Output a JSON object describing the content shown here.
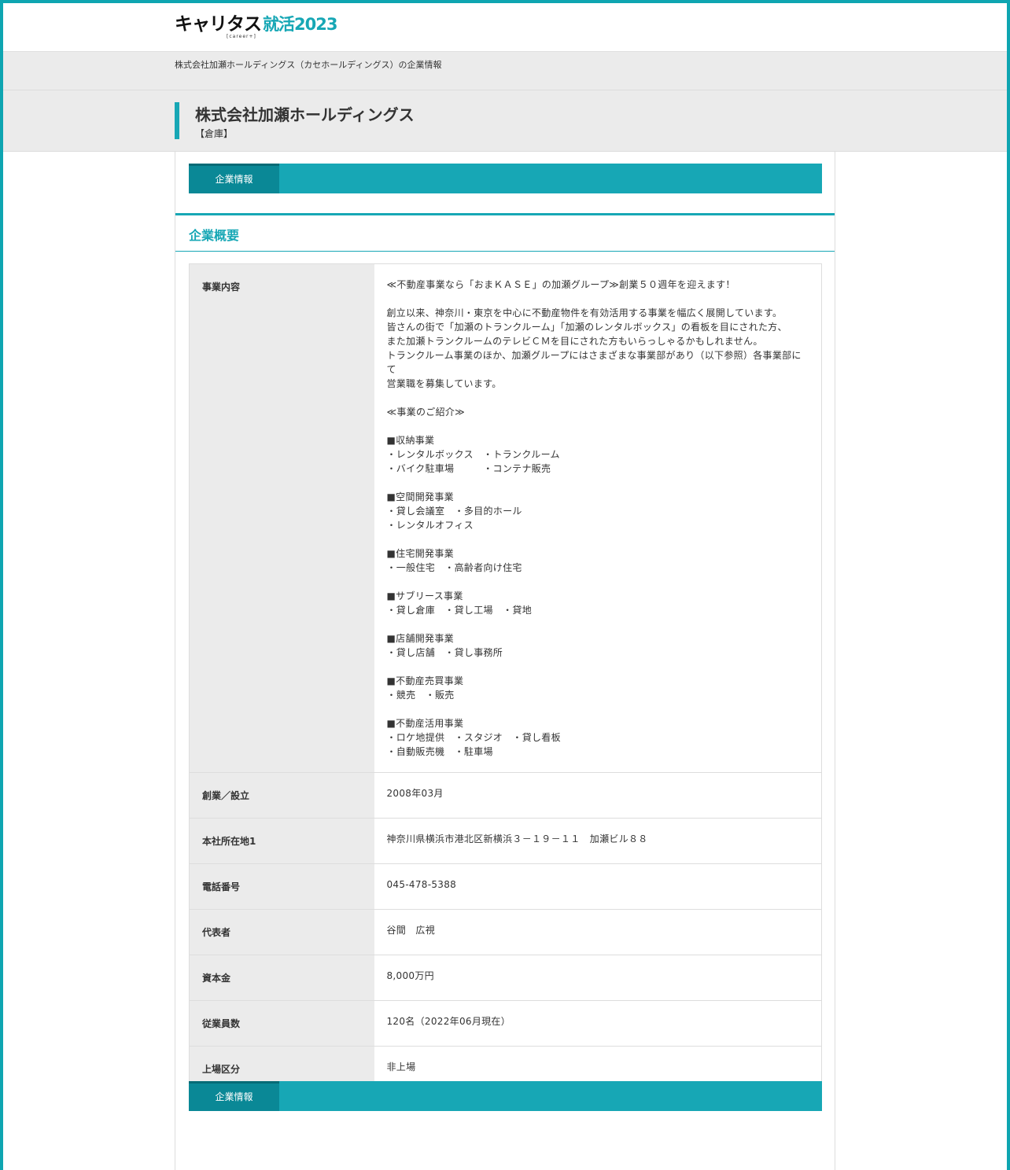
{
  "header": {
    "logo_main": "キャリタス",
    "logo_accent": "就活2023",
    "logo_sub": "[career+]"
  },
  "breadcrumb": "株式会社加瀬ホールディングス（カセホールディングス）の企業情報",
  "company": {
    "name": "株式会社加瀬ホールディングス",
    "industry": "【倉庫】"
  },
  "tabs": {
    "top_label": "企業情報",
    "bottom_label": "企業情報"
  },
  "section": {
    "title": "企業概要"
  },
  "rows": [
    {
      "label": "事業内容",
      "value": "≪不動産事業なら「おまＫＡＳＥ」の加瀬グループ≫創業５０週年を迎えます！\n\n創立以来、神奈川・東京を中心に不動産物件を有効活用する事業を幅広く展開しています。\n皆さんの街で「加瀬のトランクルーム」「加瀬のレンタルボックス」の看板を目にされた方、\nまた加瀬トランクルームのテレビＣＭを目にされた方もいらっしゃるかもしれません。\nトランクルーム事業のほか、加瀬グループにはさまざまな事業部があり（以下参照）各事業部にて\n営業職を募集しています。\n\n≪事業のご紹介≫\n\n■収納事業\n・レンタルボックス　・トランクルーム\n・バイク駐車場　　　・コンテナ販売\n\n■空間開発事業\n・貸し会議室　・多目的ホール\n・レンタルオフィス\n\n■住宅開発事業\n・一般住宅　・高齢者向け住宅\n\n■サブリース事業\n・貸し倉庫　・貸し工場　・貸地\n\n■店舗開発事業\n・貸し店舗　・貸し事務所\n\n■不動産売買事業\n・競売　・販売\n\n■不動産活用事業\n・ロケ地提供　・スタジオ　・貸し看板\n・自動販売機　・駐車場"
    },
    {
      "label": "創業／設立",
      "value": "2008年03月"
    },
    {
      "label": "本社所在地1",
      "value": "神奈川県横浜市港北区新横浜３－１９－１１　加瀬ビル８８"
    },
    {
      "label": "電話番号",
      "value": "045-478-5388"
    },
    {
      "label": "代表者",
      "value": "谷間　広視"
    },
    {
      "label": "資本金",
      "value": "8,000万円"
    },
    {
      "label": "従業員数",
      "value": "120名（2022年06月現在）"
    },
    {
      "label": "上場区分",
      "value": "非上場"
    }
  ],
  "colors": {
    "accent": "#17a7b5",
    "tab_active": "#0a8896",
    "label_bg": "#ebebeb"
  }
}
